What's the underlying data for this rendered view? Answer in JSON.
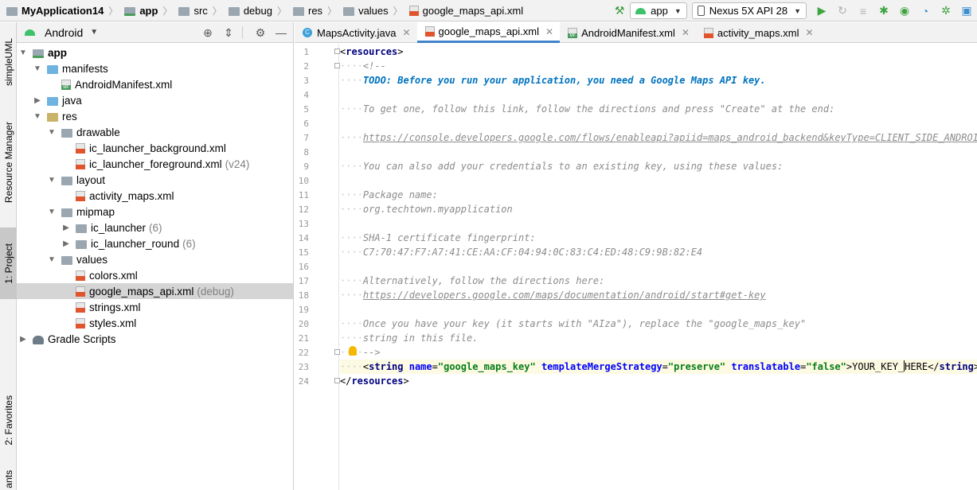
{
  "breadcrumbs": [
    {
      "label": "MyApplication14",
      "icon": "project-folder-icon",
      "bold": true
    },
    {
      "label": "app",
      "icon": "module-folder-icon",
      "bold": true
    },
    {
      "label": "src",
      "icon": "folder-icon"
    },
    {
      "label": "debug",
      "icon": "folder-icon"
    },
    {
      "label": "res",
      "icon": "folder-icon"
    },
    {
      "label": "values",
      "icon": "folder-icon"
    },
    {
      "label": "google_maps_api.xml",
      "icon": "xml-file-icon"
    }
  ],
  "toolbar": {
    "config": "app",
    "device": "Nexus 5X API 28"
  },
  "left_strip": {
    "tabs": [
      "simpleUML",
      "Resource Manager",
      "1: Project",
      "2: Favorites",
      "ants"
    ]
  },
  "project_panel": {
    "view": "Android",
    "tree": [
      {
        "label": "app",
        "suffix": "",
        "arrow": "▼",
        "icon": "module",
        "bold": true
      },
      {
        "label": "manifests",
        "suffix": "",
        "arrow": "▼",
        "icon": "folder-blue"
      },
      {
        "label": "AndroidManifest.xml",
        "suffix": "",
        "arrow": "",
        "icon": "manifest"
      },
      {
        "label": "java",
        "suffix": "",
        "arrow": "▶",
        "icon": "folder-blue"
      },
      {
        "label": "res",
        "suffix": "",
        "arrow": "▼",
        "icon": "res"
      },
      {
        "label": "drawable",
        "suffix": "",
        "arrow": "▼",
        "icon": "folder"
      },
      {
        "label": "ic_launcher_background.xml",
        "suffix": "",
        "arrow": "",
        "icon": "xml"
      },
      {
        "label": "ic_launcher_foreground.xml",
        "suffix": "(v24)",
        "arrow": "",
        "icon": "xml"
      },
      {
        "label": "layout",
        "suffix": "",
        "arrow": "▼",
        "icon": "folder"
      },
      {
        "label": "activity_maps.xml",
        "suffix": "",
        "arrow": "",
        "icon": "xml"
      },
      {
        "label": "mipmap",
        "suffix": "",
        "arrow": "▼",
        "icon": "folder"
      },
      {
        "label": "ic_launcher",
        "suffix": "(6)",
        "arrow": "▶",
        "icon": "folder"
      },
      {
        "label": "ic_launcher_round",
        "suffix": "(6)",
        "arrow": "▶",
        "icon": "folder"
      },
      {
        "label": "values",
        "suffix": "",
        "arrow": "▼",
        "icon": "folder"
      },
      {
        "label": "colors.xml",
        "suffix": "",
        "arrow": "",
        "icon": "xml"
      },
      {
        "label": "google_maps_api.xml",
        "suffix": "(debug)",
        "arrow": "",
        "icon": "xml",
        "selected": true
      },
      {
        "label": "strings.xml",
        "suffix": "",
        "arrow": "",
        "icon": "xml"
      },
      {
        "label": "styles.xml",
        "suffix": "",
        "arrow": "",
        "icon": "xml"
      },
      {
        "label": "Gradle Scripts",
        "suffix": "",
        "arrow": "▶",
        "icon": "gradle"
      }
    ]
  },
  "tabs": [
    {
      "label": "MapsActivity.java",
      "icon": "class-icon",
      "active": false
    },
    {
      "label": "google_maps_api.xml",
      "icon": "xml-file-icon",
      "active": true
    },
    {
      "label": "AndroidManifest.xml",
      "icon": "manifest-file-icon",
      "active": false
    },
    {
      "label": "activity_maps.xml",
      "icon": "xml-file-icon",
      "active": false
    }
  ],
  "editor": {
    "line_numbers": [
      "1",
      "2",
      "3",
      "4",
      "5",
      "6",
      "7",
      "8",
      "9",
      "10",
      "11",
      "12",
      "13",
      "14",
      "15",
      "16",
      "17",
      "18",
      "19",
      "20",
      "21",
      "22",
      "23",
      "24"
    ],
    "code": {
      "l1_tag": "resources",
      "l2": "<!--",
      "l3": "TODO: Before you run your application, you need a Google Maps API key.",
      "l5": "To get one, follow this link, follow the directions and press \"Create\" at the end:",
      "l7": "https://console.developers.google.com/flows/enableapi?apiid=maps_android_backend&keyType=CLIENT_SIDE_ANDROID&r",
      "l9": "You can also add your credentials to an existing key, using these values:",
      "l11": "Package name:",
      "l12": "org.techtown.myapplication",
      "l14": "SHA-1 certificate fingerprint:",
      "l15": "C7:70:47:F7:A7:41:CE:AA:CF:04:94:0C:83:C4:ED:48:C9:9B:82:E4",
      "l17": "Alternatively, follow the directions here:",
      "l18": "https://developers.google.com/maps/documentation/android/start#get-key",
      "l20": "Once you have your key (it starts with \"AIza\"), replace the \"google_maps_key\"",
      "l21": "string in this file.",
      "l22": "-->",
      "l23_tag": "string",
      "l23_attr1": "name",
      "l23_val1": "\"google_maps_key\"",
      "l23_attr2": "templateMergeStrategy",
      "l23_val2": "\"preserve\"",
      "l23_attr3": "translatable",
      "l23_val3": "\"false\"",
      "l23_text_a": "YOUR_KEY_",
      "l23_text_b": "HERE",
      "l24_tag": "resources"
    }
  }
}
